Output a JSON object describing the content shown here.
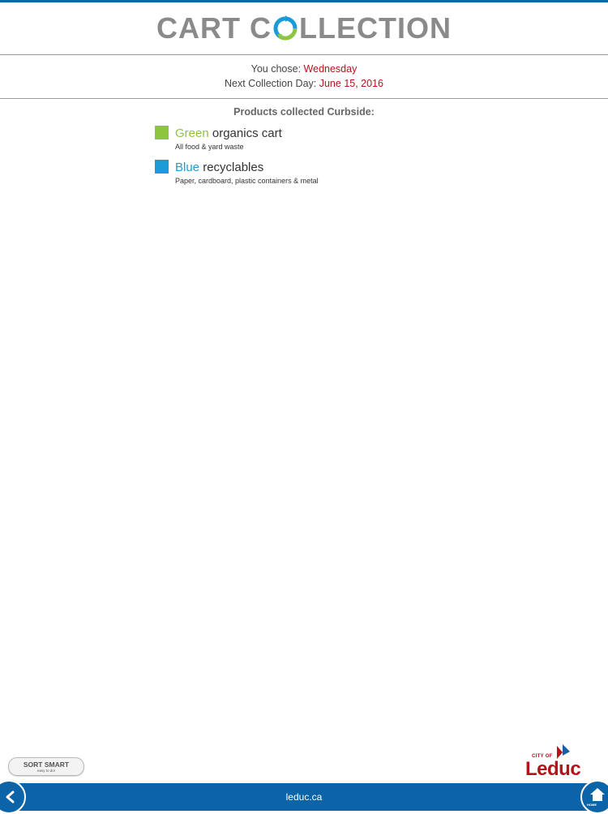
{
  "header": {
    "title_part1": "CART C",
    "title_part2": "LLECTION"
  },
  "selection": {
    "chose_label": "You chose:",
    "chose_value": "Wednesday",
    "next_label": "Next Collection Day:",
    "next_value": "June 15, 2016"
  },
  "products": {
    "heading": "Products collected Curbside:",
    "items": [
      {
        "color_word": "Green",
        "rest": "organics cart",
        "desc": "All food & yard waste",
        "color": "#8dc541"
      },
      {
        "color_word": "Blue",
        "rest": "recyclables",
        "desc": "Paper, cardboard, plastic containers & metal",
        "color": "#1a9bd7"
      }
    ]
  },
  "sort_smart": {
    "label": "SORT SMART",
    "tagline": "easy to do!"
  },
  "logo": {
    "city_of": "CITY OF",
    "name": "Leduc"
  },
  "footer": {
    "site": "leduc.ca",
    "home_label": "HOME"
  },
  "colors": {
    "brand_blue": "#0b63a8",
    "accent_red": "#b3141c"
  },
  "icons": {
    "back": "chevron-left-icon",
    "home": "home-icon",
    "title_o": "recycle-arrows-icon"
  }
}
